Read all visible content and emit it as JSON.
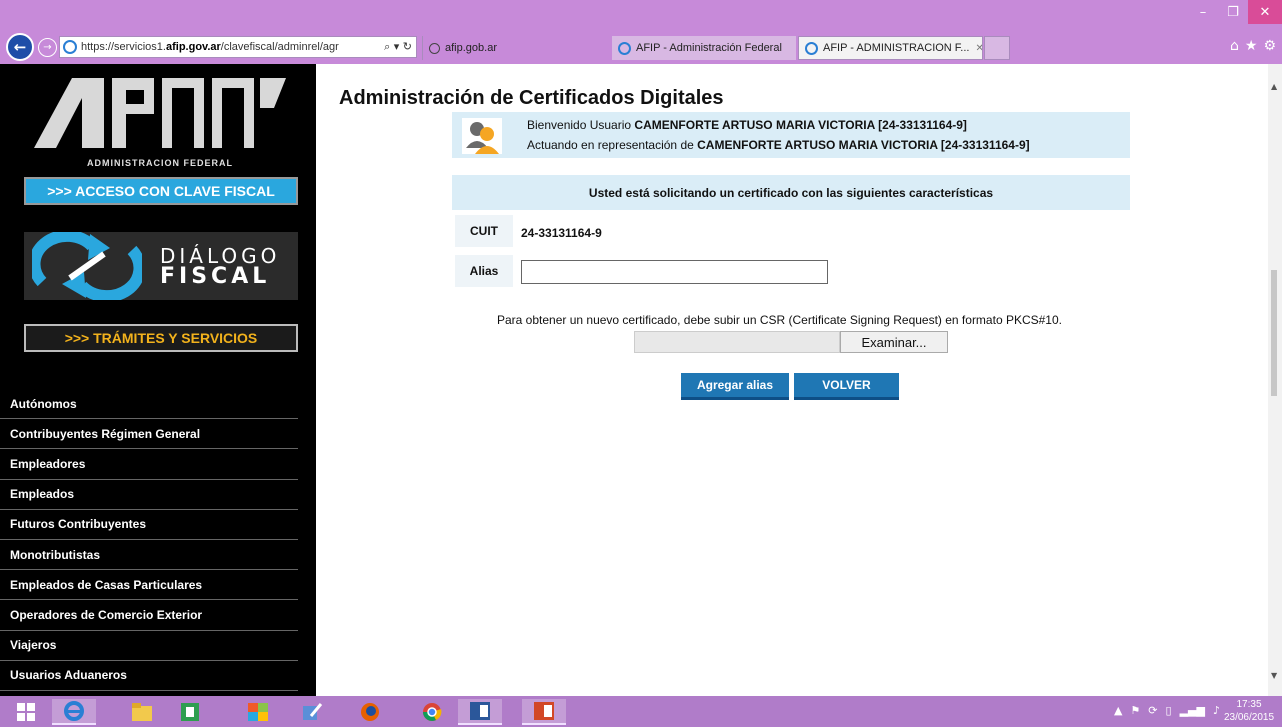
{
  "browser": {
    "url_prefix": "https://servicios1.",
    "url_domain": "afip.gov.ar",
    "url_rest": "/clavefiscal/adminrel/agr",
    "url_controls": "⌕ ▾ ↻",
    "tabs": [
      {
        "label": "afip.gob.ar"
      },
      {
        "label": "AFIP - Administración Federal"
      },
      {
        "label": "AFIP - ADMINISTRACION F..."
      }
    ],
    "tab_close": "✕",
    "window_controls": {
      "minimize": "–",
      "restore": "❐",
      "close": "✕"
    },
    "toolbar_icons": {
      "home": "⌂",
      "favorites": "★",
      "settings": "⚙"
    }
  },
  "sidebar": {
    "logo_caption": "ADMINISTRACION FEDERAL",
    "clave_fiscal": ">>> ACCESO CON CLAVE FISCAL",
    "dialogo_line1": "DIÁLOGO",
    "dialogo_line2": "FISCAL",
    "tramites": ">>> TRÁMITES Y SERVICIOS",
    "menu": [
      "Autónomos",
      "Contribuyentes Régimen General",
      "Empleadores",
      "Empleados",
      "Futuros Contribuyentes",
      "Monotributistas",
      "Empleados de Casas Particulares",
      "Operadores de Comercio Exterior",
      "Viajeros",
      "Usuarios Aduaneros"
    ]
  },
  "main": {
    "title": "Administración de Certificados Digitales",
    "welcome_prefix": "Bienvenido Usuario ",
    "welcome_user": "CAMENFORTE ARTUSO MARIA VICTORIA [24-33131164-9]",
    "acting_prefix": "Actuando en representación de ",
    "acting_user": "CAMENFORTE ARTUSO MARIA VICTORIA [24-33131164-9]",
    "request_header": "Usted está solicitando un certificado con las siguientes características",
    "cuit_label": "CUIT",
    "cuit_value": "24-33131164-9",
    "alias_label": "Alias",
    "alias_value": "",
    "csr_instruction": "Para obtener un nuevo certificado, debe subir un CSR (Certificate Signing Request) en formato PKCS#10.",
    "browse_label": "Examinar...",
    "add_alias_label": "Agregar alias",
    "back_label": "VOLVER"
  },
  "taskbar": {
    "time": "17:35",
    "date": "23/06/2015"
  },
  "colors": {
    "chrome": "#c78ad9",
    "taskbar": "#b07cc9",
    "accent_blue": "#1f77b4",
    "info_bg": "#daedf7",
    "clave_fiscal": "#2aa7de",
    "tramites": "#f2b21c"
  }
}
